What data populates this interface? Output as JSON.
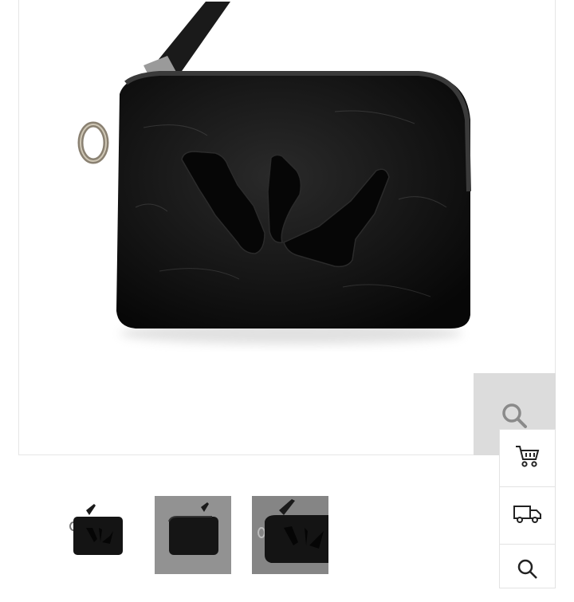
{
  "product": {
    "image_icon": "black-leather-wallet-photo",
    "leather_color": "#121212",
    "background_color": "#ffffff"
  },
  "zoom": {
    "icon": "magnifier-icon",
    "background": "#dcdcdc"
  },
  "side_actions": [
    {
      "icon": "cart-icon"
    },
    {
      "icon": "delivery-truck-icon"
    },
    {
      "icon": "search-icon"
    }
  ],
  "thumbnails": [
    {
      "icon": "wallet-thumbnail-front",
      "background": "#ffffff"
    },
    {
      "icon": "wallet-thumbnail-gray",
      "background": "#8a8a8a"
    },
    {
      "icon": "wallet-thumbnail-angle",
      "background": "#7c7c7c"
    }
  ]
}
